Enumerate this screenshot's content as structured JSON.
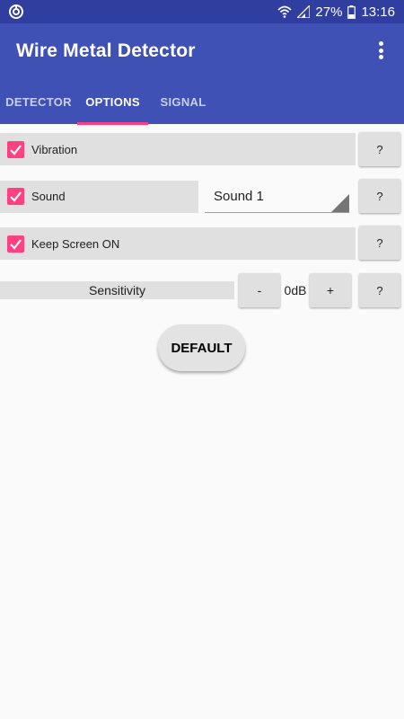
{
  "status_bar": {
    "battery": "27%",
    "time": "13:16",
    "left_icon": "notification-icon",
    "icons": [
      "wifi-icon",
      "signal-icon",
      "battery-icon"
    ]
  },
  "app": {
    "title": "Wire Metal Detector",
    "overflow_icon": "more-vert-icon"
  },
  "tabs": [
    {
      "label": "DETECTOR",
      "active": false
    },
    {
      "label": "OPTIONS",
      "active": true
    },
    {
      "label": "SIGNAL",
      "active": false
    }
  ],
  "options": {
    "vibration": {
      "label": "Vibration",
      "checked": true,
      "help": "?"
    },
    "sound": {
      "label": "Sound",
      "checked": true,
      "help": "?",
      "selected": "Sound 1"
    },
    "keep_screen": {
      "label": "Keep Screen ON",
      "checked": true,
      "help": "?"
    },
    "sensitivity": {
      "label": "Sensitivity",
      "minus": "-",
      "value": "0dB",
      "plus": "+",
      "help": "?"
    }
  },
  "default_button": "DEFAULT",
  "colors": {
    "primary": "#3f51b5",
    "primary_dark": "#303f9f",
    "accent": "#ff4081"
  }
}
